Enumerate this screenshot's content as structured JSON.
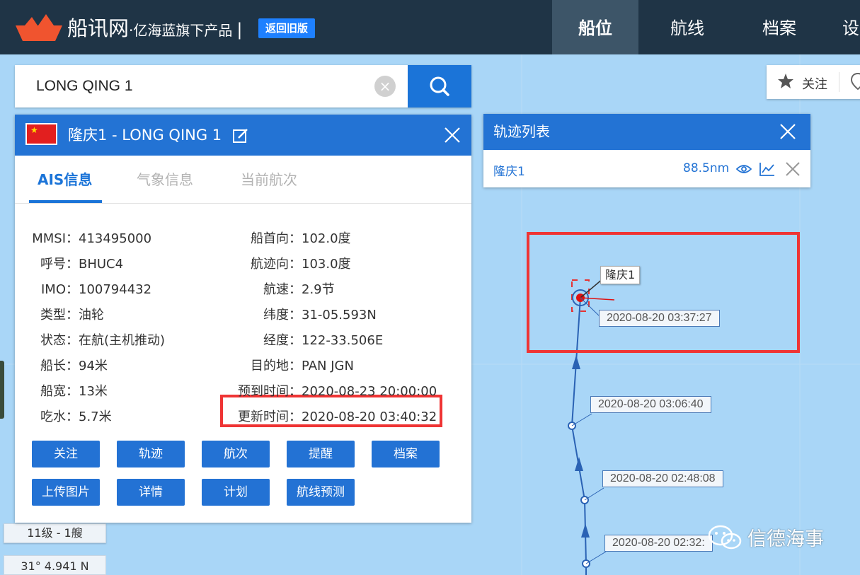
{
  "header": {
    "brand": "船讯网",
    "brand_sub": "·亿海蓝旗下产品",
    "old_version": "返回旧版",
    "nav": [
      "船位",
      "航线",
      "档案",
      "设"
    ]
  },
  "search": {
    "value": "LONG QING 1",
    "placeholder": ""
  },
  "ship_panel": {
    "title": "隆庆1 -  LONG QING 1",
    "tabs": [
      "AIS信息",
      "气象信息",
      "当前航次"
    ],
    "fields_left": [
      {
        "label": "MMSI：",
        "value": "413495000"
      },
      {
        "label": "呼号：",
        "value": "BHUC4"
      },
      {
        "label": "IMO：",
        "value": "100794432"
      },
      {
        "label": "类型：",
        "value": "油轮"
      },
      {
        "label": "状态：",
        "value": "在航(主机推动)"
      },
      {
        "label": "船长：",
        "value": "94米"
      },
      {
        "label": "船宽：",
        "value": "13米"
      },
      {
        "label": "吃水：",
        "value": "5.7米"
      }
    ],
    "fields_right": [
      {
        "label": "船首向：",
        "value": "102.0度"
      },
      {
        "label": "航迹向：",
        "value": "103.0度"
      },
      {
        "label": "航速：",
        "value": "2.9节"
      },
      {
        "label": "纬度：",
        "value": "31-05.593N"
      },
      {
        "label": "经度：",
        "value": "122-33.506E"
      },
      {
        "label": "目的地：",
        "value": "PAN JGN"
      },
      {
        "label": "预到时间：",
        "value": "2020-08-23 20:00:00"
      },
      {
        "label": "更新时间：",
        "value": "2020-08-20 03:40:32"
      }
    ],
    "buttons_row1": [
      "关注",
      "轨迹",
      "航次",
      "提醒",
      "档案"
    ],
    "buttons_row2": [
      "上传图片",
      "详情",
      "计划",
      "航线预测"
    ]
  },
  "track_list": {
    "title": "轨迹列表",
    "ship": "隆庆1",
    "distance": "88.5nm"
  },
  "follow": {
    "label": "关注"
  },
  "map": {
    "ship_label": "隆庆1",
    "timestamps": [
      "2020-08-20 03:37:27",
      "2020-08-20 03:06:40",
      "2020-08-20 02:48:08",
      "2020-08-20 02:32:"
    ],
    "scale": "11级 - 1艘",
    "coord": "31° 4.941 N"
  },
  "watermark": "信德海事",
  "colors": {
    "nav_bg": "#1f3446",
    "primary": "#2373d4",
    "sea": "#a9d6f7",
    "highlight": "#ef3434"
  }
}
